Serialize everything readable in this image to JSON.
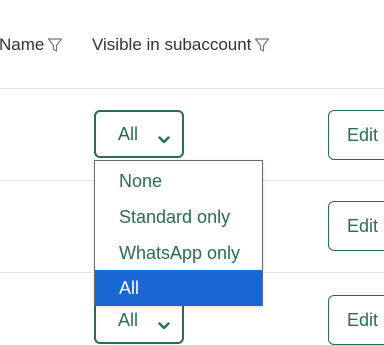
{
  "table": {
    "columns": [
      {
        "label": "Name"
      },
      {
        "label": "Visible in subaccount"
      }
    ],
    "rows": [
      {
        "visibility": "All",
        "action": "Edit"
      },
      {
        "visibility": "",
        "action": "Edit"
      },
      {
        "visibility": "All",
        "action": "Edit"
      }
    ]
  },
  "dropdown": {
    "options": [
      "None",
      "Standard only",
      "WhatsApp only",
      "All"
    ],
    "selected": "All"
  },
  "colors": {
    "accent": "#2b6e4f",
    "selection": "#1967d2",
    "divider": "#e6e6e6"
  },
  "icons": {
    "filter": "filter-icon",
    "chevron": "chevron-down-icon"
  }
}
